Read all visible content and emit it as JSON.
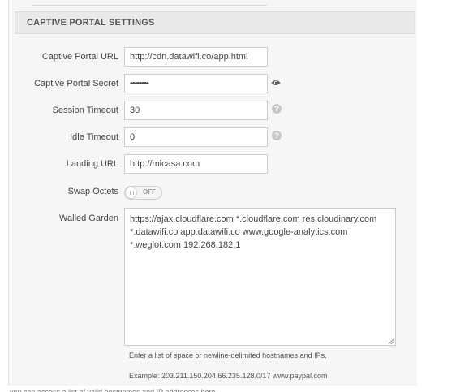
{
  "section": {
    "title": "CAPTIVE PORTAL SETTINGS"
  },
  "fields": {
    "captive_portal_url": {
      "label": "Captive Portal URL",
      "value": "http://cdn.datawifi.co/app.html"
    },
    "captive_portal_secret": {
      "label": "Captive Portal Secret",
      "value": "••••••••",
      "reveal_icon": "eye-icon"
    },
    "session_timeout": {
      "label": "Session Timeout",
      "value": "30",
      "help_icon": "question-icon"
    },
    "idle_timeout": {
      "label": "Idle Timeout",
      "value": "0",
      "help_icon": "question-icon"
    },
    "landing_url": {
      "label": "Landing URL",
      "value": "http://micasa.com"
    },
    "swap_octets": {
      "label": "Swap Octets",
      "state": "OFF"
    },
    "walled_garden": {
      "label": "Walled Garden",
      "lines": [
        "https://ajax.cloudflare.com *.cloudflare.com res.cloudinary.com",
        "*.datawifi.co app.datawifi.co www.google-analytics.com",
        "*.weglot.com 192.268.182.1"
      ],
      "hint": "Enter a list of space or newline-delimited hostnames and IPs.",
      "example": "Example: 203.211.150.204 66.235.128.0/17 www.paypal.com"
    }
  },
  "footer": {
    "cut_text": "you can access a list of valid hostnames and IP addresses here"
  },
  "colors": {
    "header_bg": "#e9e9e9",
    "panel_bg": "#f6f6f6",
    "border": "#cccccc",
    "icon_gray": "#c8c8c8"
  }
}
